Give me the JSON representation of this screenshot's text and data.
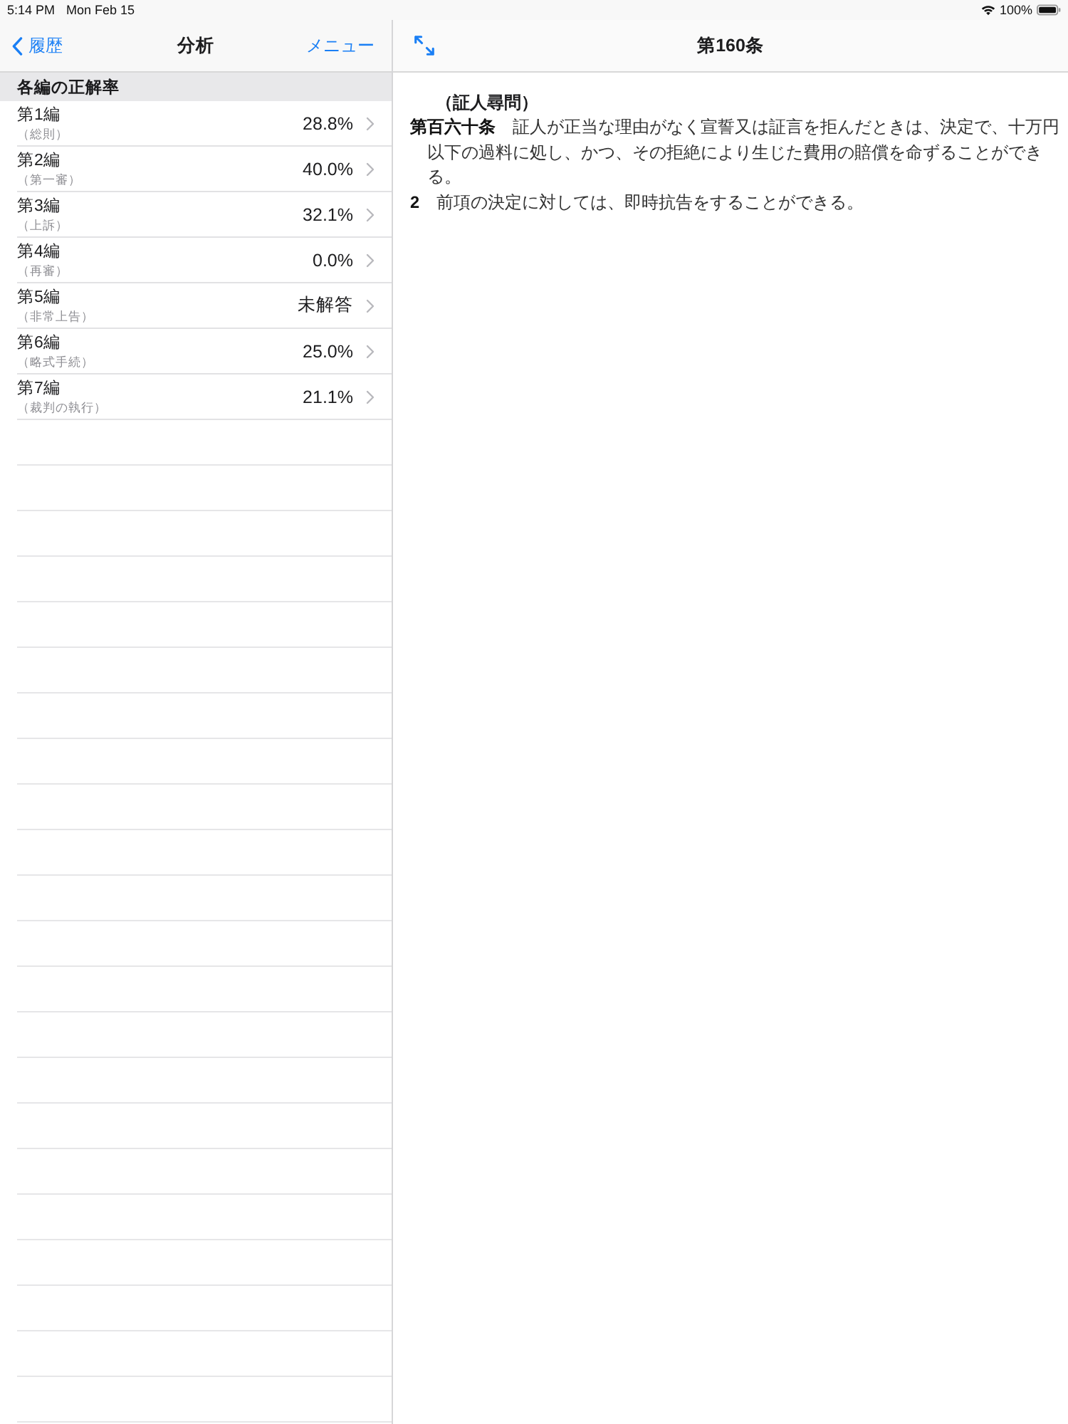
{
  "status_bar": {
    "time": "5:14 PM",
    "date": "Mon Feb 15",
    "battery": "100%"
  },
  "sidebar": {
    "nav": {
      "back": "履歴",
      "title": "分析",
      "menu": "メニュー"
    },
    "section_header": "各編の正解率",
    "items": [
      {
        "title": "第1編",
        "subtitle": "（総則）",
        "value": "28.8%"
      },
      {
        "title": "第2編",
        "subtitle": "（第一審）",
        "value": "40.0%"
      },
      {
        "title": "第3編",
        "subtitle": "（上訴）",
        "value": "32.1%"
      },
      {
        "title": "第4編",
        "subtitle": "（再審）",
        "value": "0.0%"
      },
      {
        "title": "第5編",
        "subtitle": "（非常上告）",
        "value": "未解答"
      },
      {
        "title": "第6編",
        "subtitle": "（略式手続）",
        "value": "25.0%"
      },
      {
        "title": "第7編",
        "subtitle": "（裁判の執行）",
        "value": "21.1%"
      }
    ]
  },
  "detail": {
    "title": "第160条",
    "heading": "（証人尋問）",
    "paragraphs": [
      "**第百六十条**　証人が正当な理由がなく宣誓又は証言を拒んだときは、決定で、十万円以下の過料に処し、かつ、その拒絶により生じた費用の賠償を命ずることができる。",
      "**2**　前項の決定に対しては、即時抗告をすることができる。"
    ]
  }
}
